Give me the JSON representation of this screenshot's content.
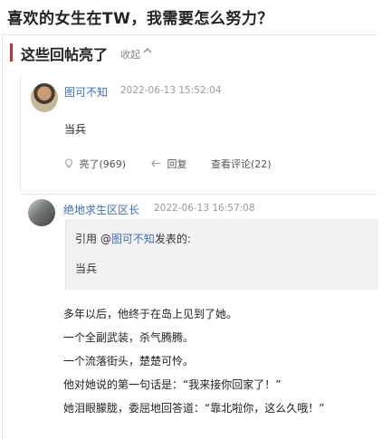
{
  "page": {
    "title": "喜欢的女生在TW，我需要怎么努力？"
  },
  "section": {
    "title": "这些回帖亮了",
    "collapse_label": "收起"
  },
  "post1": {
    "author": "图可不知",
    "time": "2022-06-13 15:52:04",
    "content": "当兵",
    "actions": {
      "like": "亮了(969)",
      "reply": "回复",
      "view_comments": "查看评论(22)"
    }
  },
  "post2": {
    "author": "绝地求生区区长",
    "time": "2022-06-13 16:57:08",
    "quote": {
      "prefix": "引用 @",
      "user": "图可不知",
      "suffix": "发表的:",
      "text": "当兵"
    },
    "lines": [
      "多年以后，他终于在岛上见到了她。",
      "一个全副武装，杀气腾腾。",
      "一个流落街头，楚楚可怜。",
      "他对她说的第一句话是：“我来接你回家了！”",
      "她泪眼朦胧，委屈地回答道：“靠北啦你，这么久哦！”"
    ]
  },
  "icons": {
    "like": "lightbulb-icon",
    "reply": "reply-arrow-icon",
    "collapse": "chevron-up-icon"
  },
  "colors": {
    "accent_red": "#d62b2b",
    "link_blue": "#3a6fc4",
    "quote_bg": "#f2f2f2"
  }
}
